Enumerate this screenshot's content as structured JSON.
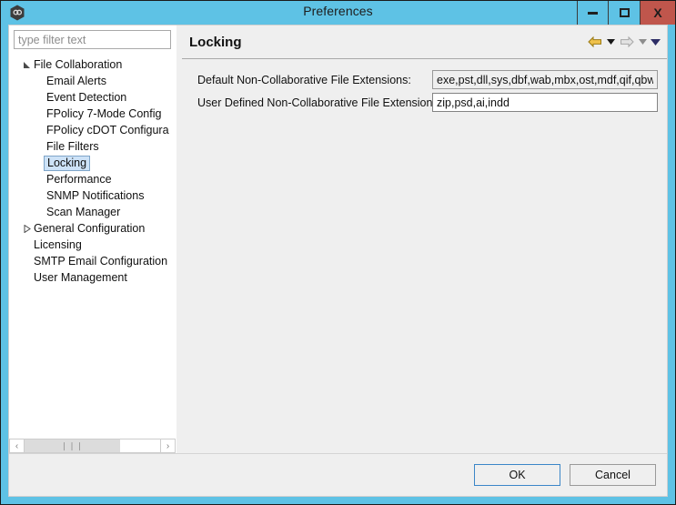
{
  "window": {
    "title": "Preferences",
    "app_icon": "app-hexagon-icon",
    "accent_color": "#5ec2e5",
    "controls": {
      "minimize_label": "Minimize",
      "maximize_label": "Maximize",
      "close_label": "X"
    }
  },
  "sidebar": {
    "filter": {
      "placeholder": "type filter text",
      "value": ""
    },
    "items": [
      {
        "label": "File Collaboration",
        "level": 0,
        "arrow": "expanded",
        "selected": false
      },
      {
        "label": "Email Alerts",
        "level": 1,
        "arrow": "none",
        "selected": false
      },
      {
        "label": "Event Detection",
        "level": 1,
        "arrow": "none",
        "selected": false
      },
      {
        "label": "FPolicy 7-Mode Config",
        "level": 1,
        "arrow": "none",
        "selected": false
      },
      {
        "label": "FPolicy cDOT Configura",
        "level": 1,
        "arrow": "none",
        "selected": false
      },
      {
        "label": "File Filters",
        "level": 1,
        "arrow": "none",
        "selected": false
      },
      {
        "label": "Locking",
        "level": 1,
        "arrow": "none",
        "selected": true
      },
      {
        "label": "Performance",
        "level": 1,
        "arrow": "none",
        "selected": false
      },
      {
        "label": "SNMP Notifications",
        "level": 1,
        "arrow": "none",
        "selected": false
      },
      {
        "label": "Scan Manager",
        "level": 1,
        "arrow": "none",
        "selected": false
      },
      {
        "label": "General Configuration",
        "level": 0,
        "arrow": "collapsed",
        "selected": false
      },
      {
        "label": "Licensing",
        "level": 0,
        "arrow": "none",
        "selected": false
      },
      {
        "label": "SMTP Email Configuration",
        "level": 0,
        "arrow": "none",
        "selected": false
      },
      {
        "label": "User Management",
        "level": 0,
        "arrow": "none",
        "selected": false
      }
    ],
    "hscroll": {
      "left_arrow": "‹",
      "right_arrow": "›",
      "grip": "❘❘❘"
    }
  },
  "page": {
    "title": "Locking",
    "nav": {
      "back_icon": "back-arrow-icon",
      "back_menu_icon": "chevron-down-icon",
      "forward_icon": "forward-arrow-icon",
      "forward_menu_icon": "chevron-down-icon",
      "overflow_icon": "chevron-down-icon"
    },
    "fields": [
      {
        "label": "Default Non-Collaborative File Extensions:",
        "value": "exe,pst,dll,sys,dbf,wab,mbx,ost,mdf,qif,qbw",
        "readonly": true
      },
      {
        "label": "User Defined Non-Collaborative File Extensions:",
        "value": "zip,psd,ai,indd",
        "readonly": false
      }
    ]
  },
  "footer": {
    "ok_label": "OK",
    "cancel_label": "Cancel"
  }
}
